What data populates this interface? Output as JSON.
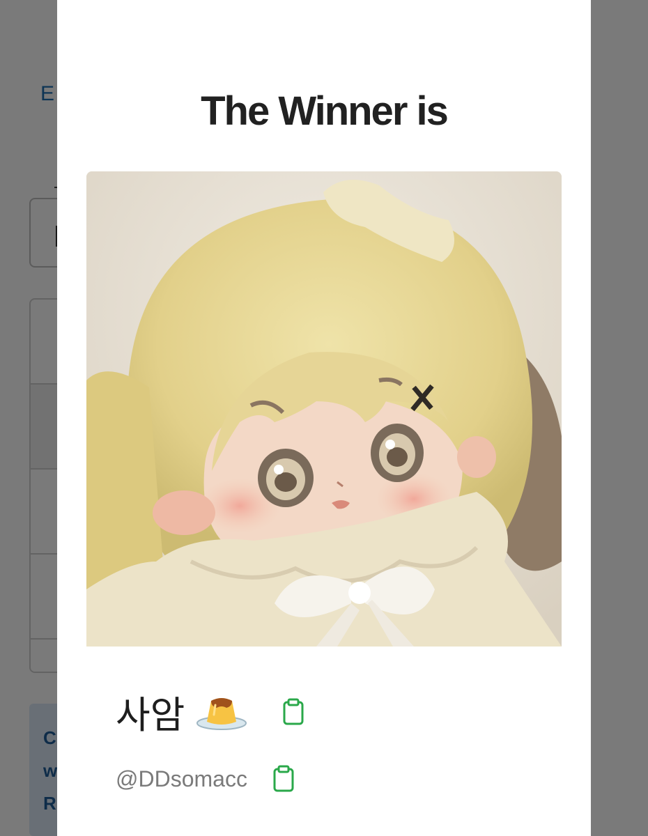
{
  "background": {
    "link_text": "E",
    "info_lines": [
      "C",
      "w",
      "R"
    ]
  },
  "modal": {
    "title": "The Winner is",
    "winner": {
      "name": "사암",
      "name_emoji_icon": "custard-pudding-icon",
      "handle": "@DDsomacc",
      "copy_icon": "clipboard-icon"
    }
  },
  "colors": {
    "copy_icon": "#2aa84a",
    "title_text": "#212121",
    "handle_text": "#7a7a7a",
    "link": "#1f6fb2"
  }
}
